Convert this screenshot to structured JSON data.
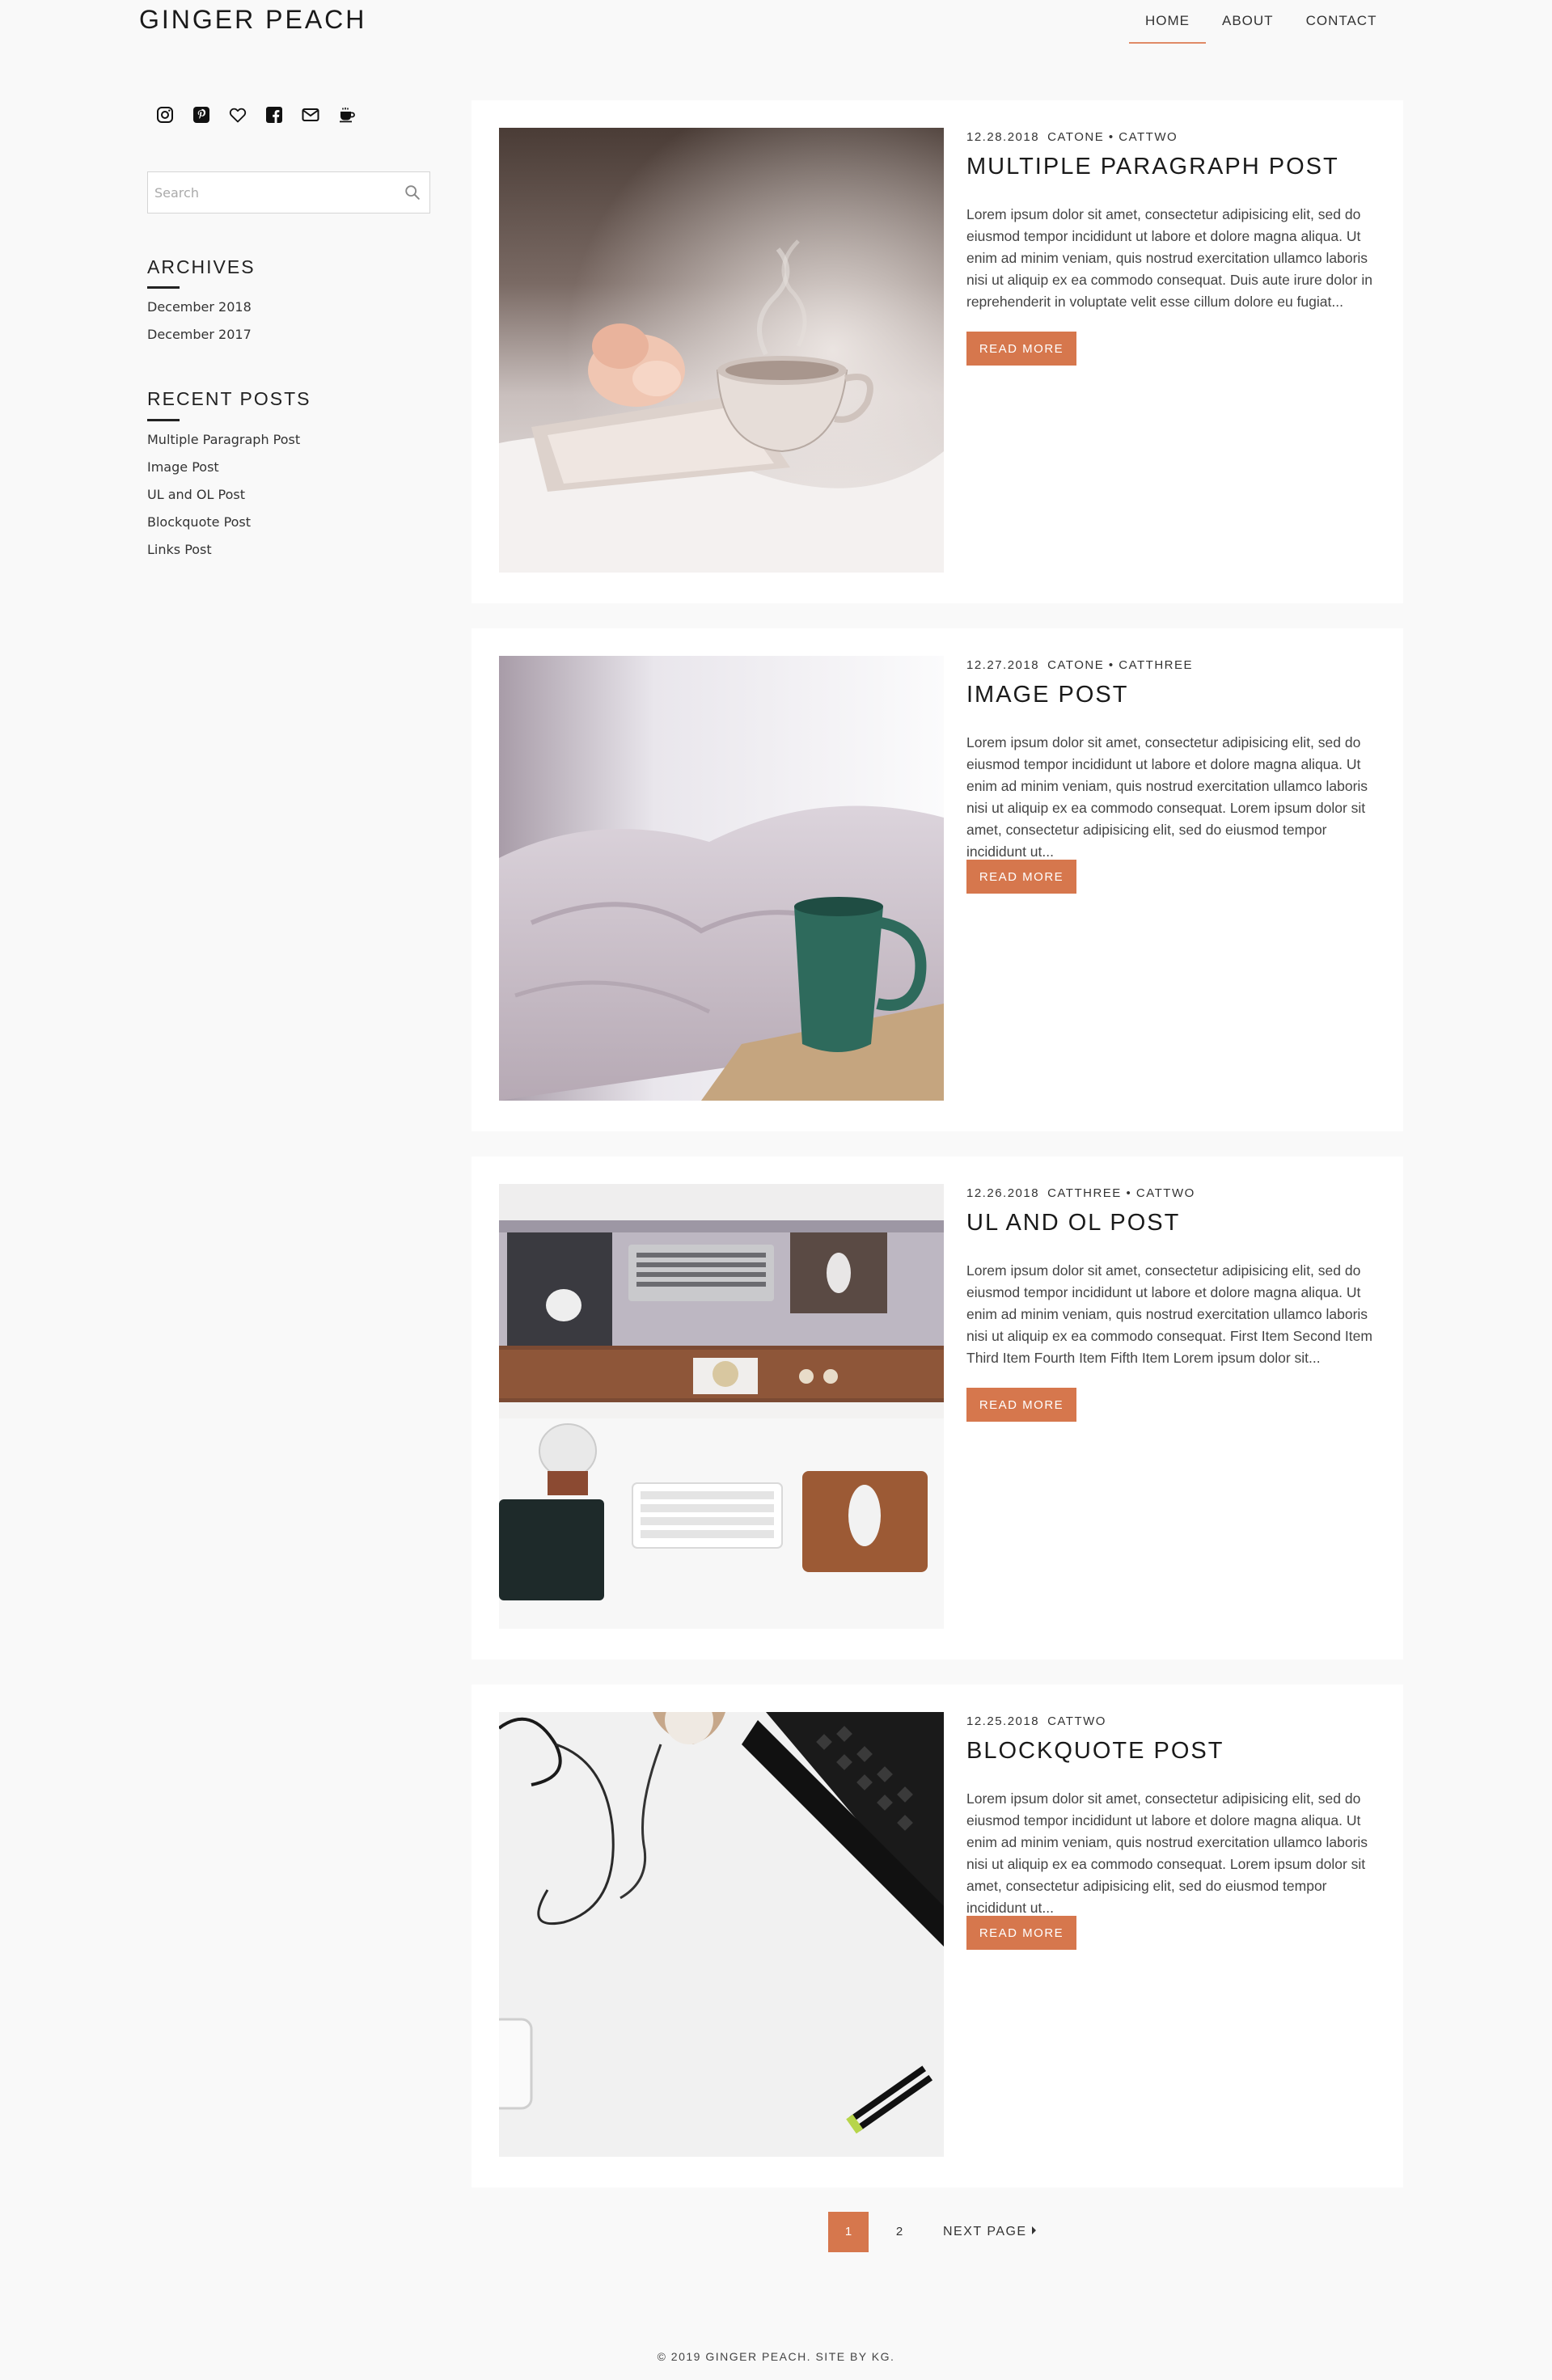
{
  "header": {
    "site_title": "GINGER PEACH",
    "nav": [
      {
        "label": "HOME",
        "active": true
      },
      {
        "label": "ABOUT",
        "active": false
      },
      {
        "label": "CONTACT",
        "active": false
      }
    ]
  },
  "sidebar": {
    "social_icons": [
      "instagram-icon",
      "pinterest-icon",
      "heart-icon",
      "facebook-icon",
      "email-icon",
      "coffee-icon"
    ],
    "search": {
      "placeholder": "Search",
      "value": ""
    },
    "archives": {
      "title": "ARCHIVES",
      "items": [
        "December 2018",
        "December 2017"
      ]
    },
    "recent_posts": {
      "title": "RECENT POSTS",
      "items": [
        "Multiple Paragraph Post",
        "Image Post",
        "UL and OL Post",
        "Blockquote Post",
        "Links Post"
      ]
    }
  },
  "posts": [
    {
      "date": "12.28.2018",
      "categories": "CATONE • CATTWO",
      "title": "MULTIPLE PARAGRAPH POST",
      "excerpt": "Lorem ipsum dolor sit amet, consectetur adipisicing elit, sed do eiusmod tempor incididunt ut labore et dolore magna aliqua. Ut enim ad minim veniam, quis nostrud exercitation ullamco laboris nisi ut aliquip ex ea commodo consequat. Duis aute irure dolor in reprehenderit in voluptate velit esse cillum dolore eu fugiat...",
      "read_more": "READ MORE",
      "image": "teacup-on-book"
    },
    {
      "date": "12.27.2018",
      "categories": "CATONE • CATTHREE",
      "title": "IMAGE POST",
      "excerpt": "Lorem ipsum dolor sit amet, consectetur adipisicing elit, sed do eiusmod tempor incididunt ut labore et dolore magna aliqua. Ut enim ad minim veniam, quis nostrud exercitation ullamco laboris nisi ut aliquip ex ea commodo consequat. Lorem ipsum dolor sit amet, consectetur adipisicing elit, sed do eiusmod tempor incididunt ut...",
      "read_more": "READ MORE",
      "image": "green-mug-bed"
    },
    {
      "date": "12.26.2018",
      "categories": "CATTHREE • CATTWO",
      "title": "UL AND OL POST",
      "excerpt": "Lorem ipsum dolor sit amet, consectetur adipisicing elit, sed do eiusmod tempor incididunt ut labore et dolore magna aliqua. Ut enim ad minim veniam, quis nostrud exercitation ullamco laboris nisi ut aliquip ex ea commodo consequat. First Item Second Item Third Item Fourth Item Fifth Item Lorem ipsum dolor sit...",
      "read_more": "READ MORE",
      "image": "desk-workspace"
    },
    {
      "date": "12.25.2018",
      "categories": "CATTWO",
      "title": "BLOCKQUOTE POST",
      "excerpt": "Lorem ipsum dolor sit amet, consectetur adipisicing elit, sed do eiusmod tempor incididunt ut labore et dolore magna aliqua. Ut enim ad minim veniam, quis nostrud exercitation ullamco laboris nisi ut aliquip ex ea commodo consequat. Lorem ipsum dolor sit amet, consectetur adipisicing elit, sed do eiusmod tempor incididunt ut...",
      "read_more": "READ MORE",
      "image": "keyboard-earphones"
    }
  ],
  "pagination": {
    "current": "1",
    "next_num": "2",
    "next_label": "NEXT PAGE"
  },
  "footer": {
    "text": "© 2019 GINGER PEACH. SITE BY KG."
  },
  "colors": {
    "accent": "#d6774d",
    "nav_underline": "#e08a66",
    "background": "#f9f9f9"
  }
}
